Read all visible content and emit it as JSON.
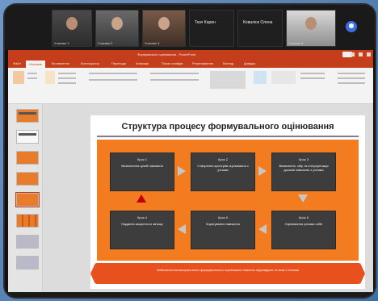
{
  "video": {
    "participants": [
      {
        "name": "Учасник 1"
      },
      {
        "name": "Учасник 2"
      },
      {
        "name": "Учасник 3"
      },
      {
        "name": "Ткач Карин",
        "label": "Ткач Карин"
      },
      {
        "name": "Ковалюк Олена",
        "label": "Ковалюк Олена"
      },
      {
        "name": "Учасник 6"
      }
    ]
  },
  "ppt": {
    "window_title": "Формувальне оцінювання - PowerPoint",
    "tabs": [
      "Файл",
      "Основне",
      "Вставлення",
      "Конструктор",
      "Переходи",
      "Анімація",
      "Показ слайдів",
      "Рецензування",
      "Вигляд",
      "Довідка"
    ]
  },
  "slide": {
    "title": "Структура процесу формувального оцінювання",
    "steps": [
      {
        "num": "Крок 1",
        "desc": "Визначення цілей навчання"
      },
      {
        "num": "Крок 2",
        "desc": "Створення критеріїв оцінювання з учнями"
      },
      {
        "num": "Крок 3",
        "desc": "Виявлення, збір та інтерпретація доказів навчання з учнями"
      },
      {
        "num": "Крок 4",
        "desc": "Надання зворотного зв'язку"
      },
      {
        "num": "Крок 5",
        "desc": "Коригування навчання"
      },
      {
        "num": "Крок 6",
        "desc": "Оцінювання учнями себе"
      }
    ],
    "banner": "Забезпечення використання формувального оцінювання повинно відповідати та всім її етапам"
  },
  "colors": {
    "accent": "#c43e1c",
    "panel": "#f47c20",
    "step_box": "#3d3d3d",
    "banner": "#e8501e",
    "arrow": "#c6c6c6",
    "up_arrow": "#c00000"
  }
}
